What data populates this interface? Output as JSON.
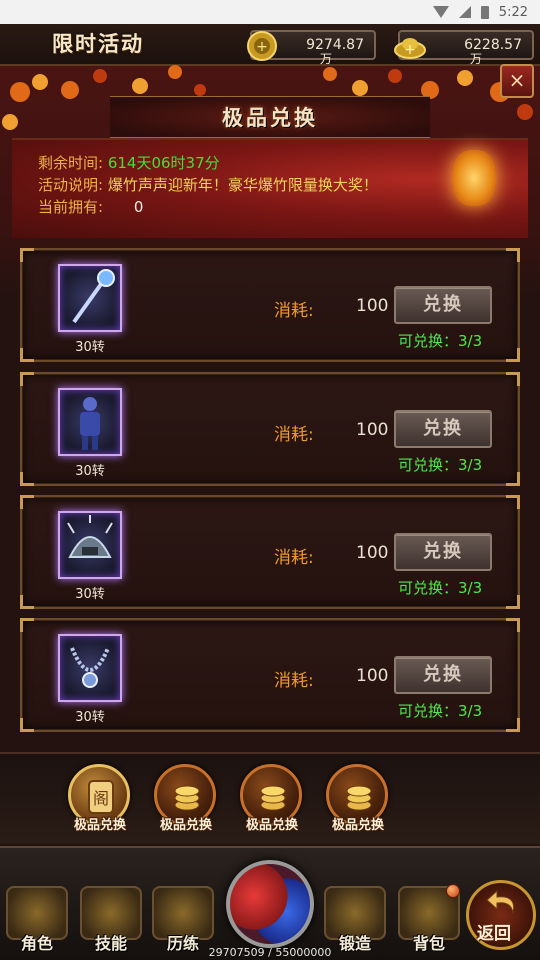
{
  "status_bar": {
    "time": "5:22"
  },
  "header": {
    "event_title": "限时活动",
    "gold": {
      "value": "9274.87",
      "unit": "万"
    },
    "ingot": {
      "value": "6228.57",
      "unit": "万"
    },
    "close_label": "×"
  },
  "subtitle": "极品兑换",
  "info": {
    "remaining_label": "剩余时间:",
    "remaining_value": "614天06时37分",
    "desc_label": "活动说明:",
    "desc_value": "爆竹声声迎新年！豪华爆竹限量换大奖！",
    "owned_label": "当前拥有:",
    "owned_value": "0"
  },
  "items": [
    {
      "icon": "staff-icon",
      "tier": "30转",
      "cost_label": "消耗:",
      "cost": "100",
      "button": "兑换",
      "remaining": "可兑换：3/3"
    },
    {
      "icon": "armor-figure-icon",
      "tier": "30转",
      "cost_label": "消耗:",
      "cost": "100",
      "button": "兑换",
      "remaining": "可兑换：3/3"
    },
    {
      "icon": "helmet-icon",
      "tier": "30转",
      "cost_label": "消耗:",
      "cost": "100",
      "button": "兑换",
      "remaining": "可兑换：3/3"
    },
    {
      "icon": "necklace-icon",
      "tier": "30转",
      "cost_label": "消耗:",
      "cost": "100",
      "button": "兑换",
      "remaining": "可兑换：3/3"
    }
  ],
  "tabs": [
    {
      "label": "极品兑换",
      "active": true
    },
    {
      "label": "极品兑换",
      "active": false
    },
    {
      "label": "极品兑换",
      "active": false
    },
    {
      "label": "极品兑换",
      "active": false
    }
  ],
  "bottom_nav": [
    {
      "label": "角色",
      "icon": "helmet-icon"
    },
    {
      "label": "技能",
      "icon": "scroll-icon"
    },
    {
      "label": "历练",
      "icon": "crossed-swords-icon"
    },
    {
      "label": "锻造",
      "icon": "anvil-icon"
    },
    {
      "label": "背包",
      "icon": "bag-icon"
    }
  ],
  "return_label": "返回",
  "exp_text": "29707509 / 55000000",
  "colors": {
    "accent_orange": "#f09a2a",
    "accent_green": "#4ee84a",
    "panel_red": "#7a1614"
  }
}
